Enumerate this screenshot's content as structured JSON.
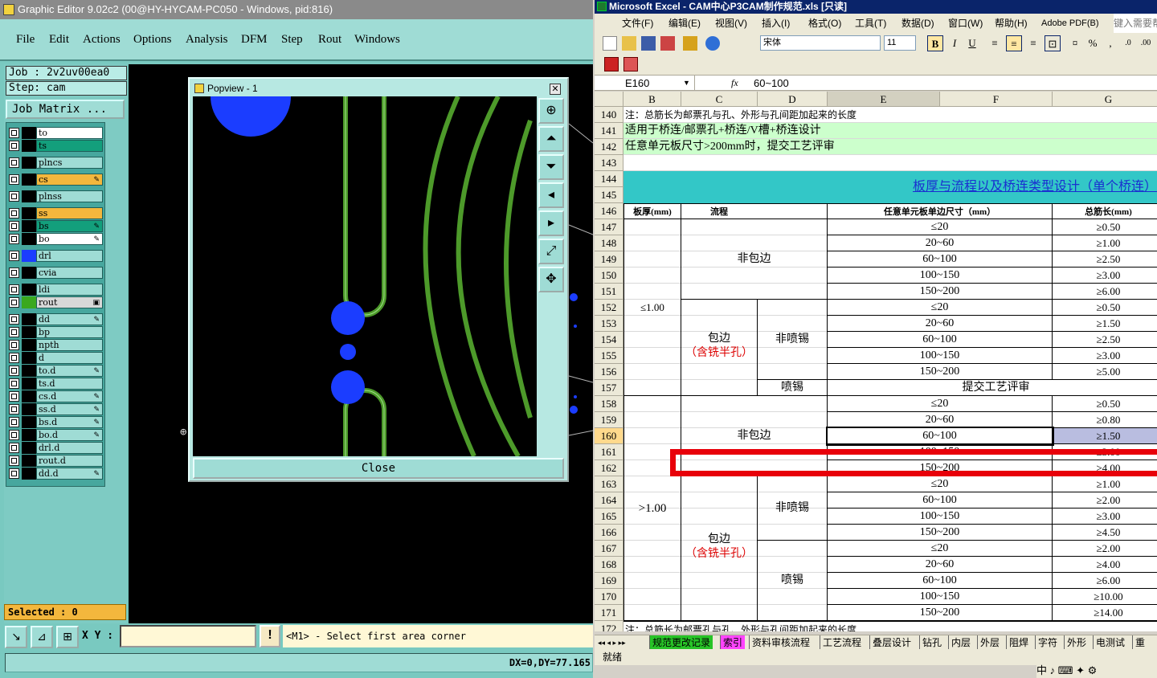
{
  "ge": {
    "title": "Graphic Editor 9.02c2 (00@HY-HYCAM-PC050 - Windows, pid:816)",
    "menu": [
      "File",
      "Edit",
      "Actions",
      "Options",
      "Analysis",
      "DFM",
      "Step",
      "Rout",
      "Windows"
    ],
    "job": "Job : 2v2uv00ea0",
    "step": "Step: cam",
    "job_matrix": "Job Matrix ...",
    "layers": [
      {
        "name": "to",
        "color": "#ffffff",
        "sw": "#000000",
        "mark": ""
      },
      {
        "name": "ts",
        "color": "#139f7c",
        "sw": "#000000",
        "mark": ""
      },
      {
        "name": "plncs",
        "color": "#9fdcd5",
        "sw": "#000000",
        "mark": ""
      },
      {
        "name": "cs",
        "color": "#f3b73d",
        "sw": "#000000",
        "mark": "✎"
      },
      {
        "name": "plnss",
        "color": "#9fdcd5",
        "sw": "#000000",
        "mark": ""
      },
      {
        "name": "ss",
        "color": "#f3b73d",
        "sw": "#000000",
        "mark": ""
      },
      {
        "name": "bs",
        "color": "#139f7c",
        "sw": "#000000",
        "mark": "✎"
      },
      {
        "name": "bo",
        "color": "#ffffff",
        "sw": "#000000",
        "mark": "✎"
      },
      {
        "name": "drl",
        "color": "#9fdcd5",
        "sw": "#1b3dff",
        "mark": ""
      },
      {
        "name": "cvia",
        "color": "#9fdcd5",
        "sw": "#000000",
        "mark": ""
      },
      {
        "name": "ldi",
        "color": "#9fdcd5",
        "sw": "#000000",
        "mark": ""
      },
      {
        "name": "rout",
        "color": "#d8d8d8",
        "sw": "#3aa81e",
        "mark": "▣"
      },
      {
        "name": "dd",
        "color": "#9fdcd5",
        "sw": "#000000",
        "mark": "✎"
      },
      {
        "name": "bp",
        "color": "#9fdcd5",
        "sw": "#000000",
        "mark": ""
      },
      {
        "name": "npth",
        "color": "#9fdcd5",
        "sw": "#000000",
        "mark": ""
      },
      {
        "name": "d",
        "color": "#9fdcd5",
        "sw": "#000000",
        "mark": ""
      },
      {
        "name": "to.d",
        "color": "#9fdcd5",
        "sw": "#000000",
        "mark": "✎"
      },
      {
        "name": "ts.d",
        "color": "#9fdcd5",
        "sw": "#000000",
        "mark": ""
      },
      {
        "name": "cs.d",
        "color": "#9fdcd5",
        "sw": "#000000",
        "mark": "✎"
      },
      {
        "name": "ss.d",
        "color": "#9fdcd5",
        "sw": "#000000",
        "mark": "✎"
      },
      {
        "name": "bs.d",
        "color": "#9fdcd5",
        "sw": "#000000",
        "mark": "✎"
      },
      {
        "name": "bo.d",
        "color": "#9fdcd5",
        "sw": "#000000",
        "mark": "✎"
      },
      {
        "name": "drl.d",
        "color": "#9fdcd5",
        "sw": "#000000",
        "mark": ""
      },
      {
        "name": "rout.d",
        "color": "#9fdcd5",
        "sw": "#000000",
        "mark": ""
      },
      {
        "name": "dd.d",
        "color": "#9fdcd5",
        "sw": "#000000",
        "mark": "✎"
      }
    ],
    "selected": "Selected : 0",
    "xy_label": "X Y :",
    "bang": "!",
    "status_msg": "<M1> - Select first area corner",
    "coords": "DX=0,DY=77.165"
  },
  "popview": {
    "title": "Popview - 1",
    "close_x": "✕",
    "close_button": "Close"
  },
  "excel": {
    "title": "Microsoft Excel - CAM中心P3CAM制作规范.xls [只读]",
    "menu": [
      "文件(F)",
      "编辑(E)",
      "视图(V)",
      "插入(I)",
      "格式(O)",
      "工具(T)",
      "数据(D)",
      "窗口(W)",
      "帮助(H)",
      "Adobe PDF(B)"
    ],
    "help_box": "键入需要帮",
    "font": "宋体",
    "size": "11",
    "name_box": "E160",
    "fx": "fx",
    "formula": "60~100",
    "columns": [
      "B",
      "C",
      "D",
      "E",
      "F",
      "G"
    ],
    "rows": [
      "140",
      "141",
      "142",
      "143",
      "144",
      "145",
      "146",
      "147",
      "148",
      "149",
      "150",
      "151",
      "152",
      "153",
      "154",
      "155",
      "156",
      "157",
      "158",
      "159",
      "160",
      "161",
      "162",
      "163",
      "164",
      "165",
      "166",
      "167",
      "168",
      "169",
      "170",
      "171",
      "172"
    ],
    "note1": "注：总筋长为邮票孔与孔、外形与孔间距加起来的长度",
    "line141": "适用于桥连/邮票孔+桥连/V槽+桥连设计",
    "line142": "任意单元板尺寸>200mm时，提交工艺评审",
    "section_title": "板厚与流程以及桥连类型设计（单个桥连）",
    "hdr_thickness": "板厚(mm)",
    "hdr_flow": "流程",
    "hdr_size": "任意单元板单边尺寸（mm）",
    "hdr_total": "总筋长(mm)",
    "thick1": "≤1.00",
    "thick2": ">1.00",
    "non_edge": "非包边",
    "edge": "包边",
    "edge_sub": "（含铣半孔）",
    "non_spray": "非喷锡",
    "spray": "喷锡",
    "review": "提交工艺评审",
    "sizes": [
      "≤20",
      "20~60",
      "60~100",
      "100~150",
      "150~200"
    ],
    "vals_147": [
      "≥0.50",
      "≥1.00",
      "≥2.50",
      "≥3.00",
      "≥6.00"
    ],
    "vals_152": [
      "≥0.50",
      "≥1.50",
      "≥2.50",
      "≥3.00",
      "≥5.00"
    ],
    "vals_158": [
      "≥0.50",
      "≥0.80",
      "≥1.50",
      "≥3.00",
      "≥4.00"
    ],
    "vals_163": [
      "≥1.00",
      "≥2.00",
      "≥3.00",
      "≥4.50"
    ],
    "vals_167": [
      "≥2.00",
      "≥4.00",
      "≥6.00",
      "≥10.00",
      "≥14.00"
    ],
    "note2": "注：总筋长为邮票孔与孔、外形与孔间距加起来的长度",
    "tabs": [
      "规范更改记录",
      "索引",
      "资料审核流程",
      "工艺流程",
      "叠层设计",
      "钻孔",
      "内层",
      "外层",
      "阻焊",
      "字符",
      "外形",
      "电测试",
      "重"
    ],
    "status": "就绪",
    "ime": "中 ♪ ⌨ ✦ ⚙"
  },
  "colors": {
    "highlight": "#e8000a",
    "section_bg": "#33c7c7",
    "green_band": "#ccffcc",
    "sheet_tab_green": "#27c427",
    "sheet_tab_magenta": "#ff44ff"
  }
}
